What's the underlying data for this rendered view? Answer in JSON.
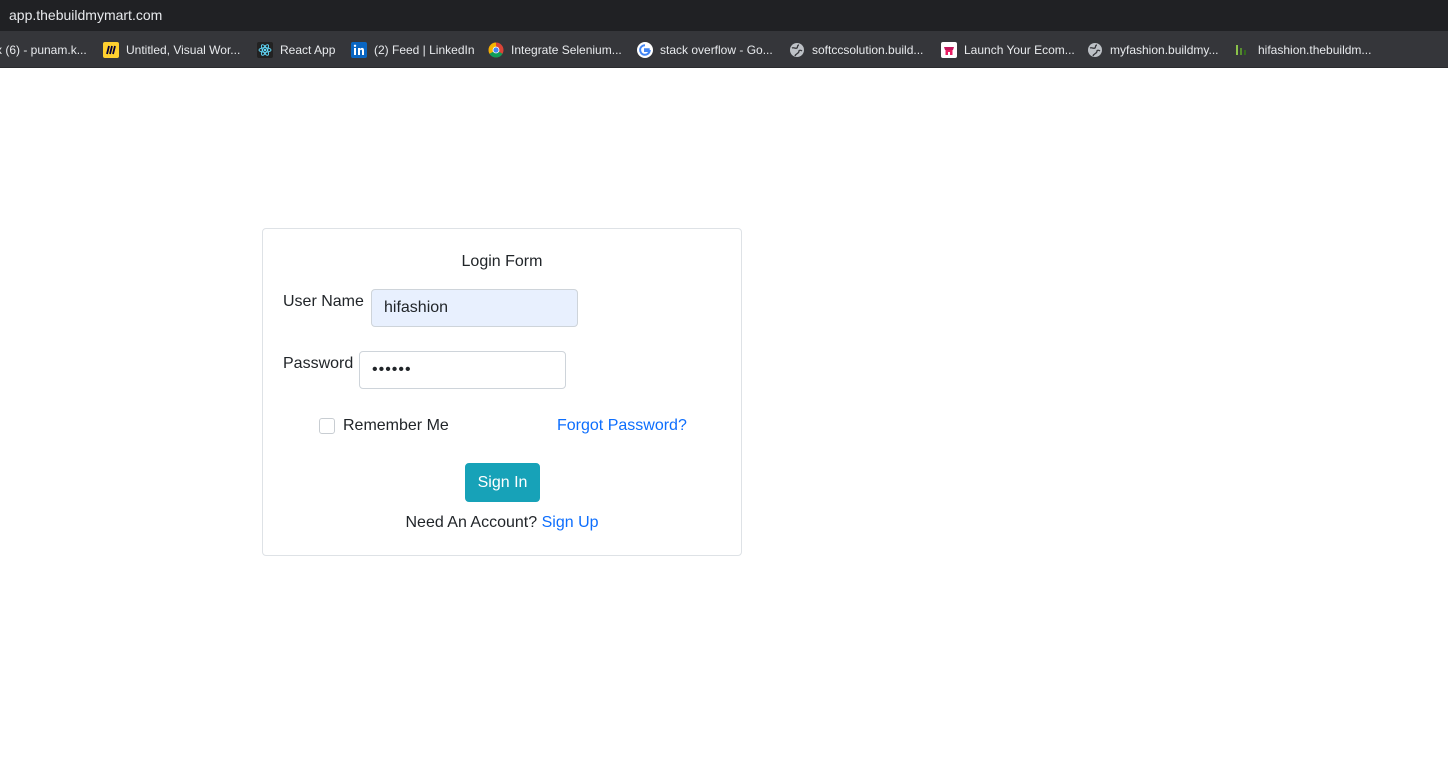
{
  "browser": {
    "url": "app.thebuildmymart.com",
    "bookmarks": [
      {
        "label": "x (6) - punam.k...",
        "icon": "mail-icon"
      },
      {
        "label": "Untitled, Visual Wor...",
        "icon": "miro-icon"
      },
      {
        "label": "React App",
        "icon": "react-icon"
      },
      {
        "label": "(2) Feed | LinkedIn",
        "icon": "linkedin-icon"
      },
      {
        "label": "Integrate Selenium...",
        "icon": "chrome-icon"
      },
      {
        "label": "stack overflow - Go...",
        "icon": "google-icon"
      },
      {
        "label": "softccsolution.build...",
        "icon": "globe-icon"
      },
      {
        "label": "Launch Your Ecom...",
        "icon": "store-icon"
      },
      {
        "label": "myfashion.buildmy...",
        "icon": "globe-icon"
      },
      {
        "label": "hifashion.thebuildm...",
        "icon": "site-icon"
      }
    ]
  },
  "login": {
    "title": "Login Form",
    "username_label": "User Name",
    "username_value": "hifashion",
    "password_label": "Password",
    "password_value": "••••••",
    "remember_label": "Remember Me",
    "remember_checked": false,
    "forgot_label": "Forgot Password?",
    "signin_label": "Sign In",
    "need_account_text": "Need An Account?",
    "signup_label": "Sign Up"
  },
  "colors": {
    "accent_button": "#17a2b8",
    "link": "#0d6efd",
    "autofill_bg": "#e8f0fe",
    "chrome_dark": "#202124"
  }
}
